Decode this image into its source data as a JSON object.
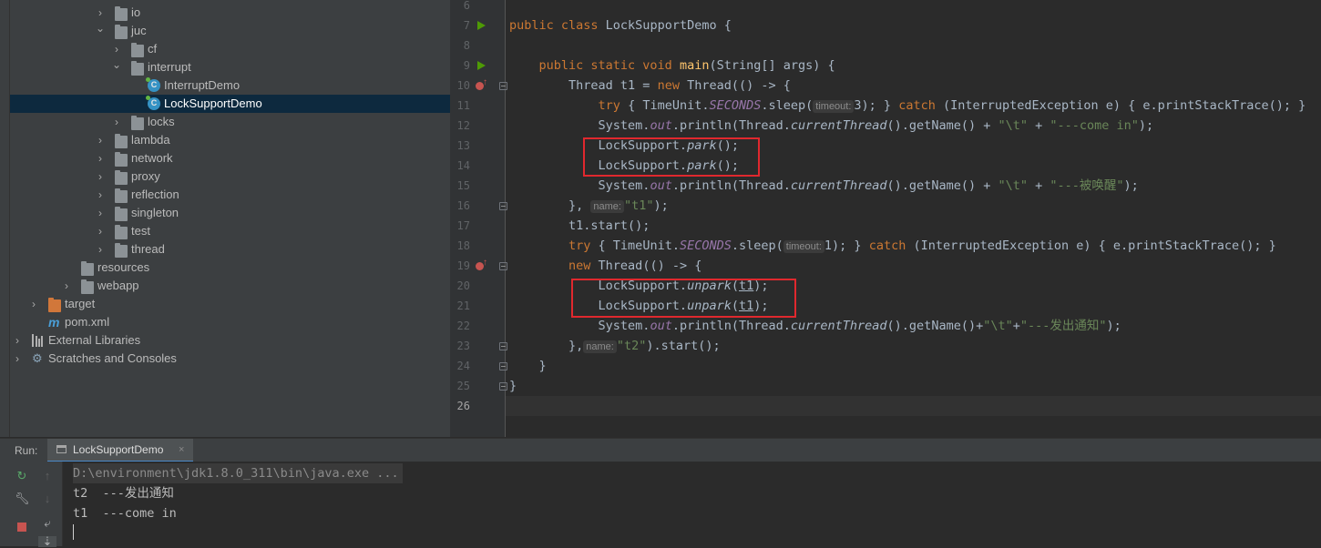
{
  "project_tree": {
    "items": [
      {
        "label": "io",
        "type": "folder",
        "indent": 1,
        "expanded": false
      },
      {
        "label": "juc",
        "type": "folder",
        "indent": 1,
        "expanded": true
      },
      {
        "label": "cf",
        "type": "folder",
        "indent": 2,
        "expanded": false
      },
      {
        "label": "interrupt",
        "type": "folder",
        "indent": 2,
        "expanded": true
      },
      {
        "label": "InterruptDemo",
        "type": "class",
        "indent": 3
      },
      {
        "label": "LockSupportDemo",
        "type": "class",
        "indent": 3,
        "selected": true
      },
      {
        "label": "locks",
        "type": "folder",
        "indent": 2,
        "expanded": false
      },
      {
        "label": "lambda",
        "type": "folder",
        "indent": 1,
        "expanded": false
      },
      {
        "label": "network",
        "type": "folder",
        "indent": 1,
        "expanded": false
      },
      {
        "label": "proxy",
        "type": "folder",
        "indent": 1,
        "expanded": false
      },
      {
        "label": "reflection",
        "type": "folder",
        "indent": 1,
        "expanded": false
      },
      {
        "label": "singleton",
        "type": "folder",
        "indent": 1,
        "expanded": false
      },
      {
        "label": "test",
        "type": "folder",
        "indent": 1,
        "expanded": false
      },
      {
        "label": "thread",
        "type": "folder",
        "indent": 1,
        "expanded": false
      },
      {
        "label": "resources",
        "type": "resources",
        "indent": 0
      },
      {
        "label": "webapp",
        "type": "webapp",
        "indent": 0,
        "expanded": false
      },
      {
        "label": "target",
        "type": "target",
        "indent": -1,
        "expanded": false
      },
      {
        "label": "pom.xml",
        "type": "maven",
        "indent": -1
      },
      {
        "label": "External Libraries",
        "type": "libraries",
        "indent": -2,
        "expanded": false
      },
      {
        "label": "Scratches and Consoles",
        "type": "scratches",
        "indent": -2,
        "expanded": false
      }
    ]
  },
  "editor": {
    "line_numbers": [
      "6",
      "7",
      "8",
      "9",
      "10",
      "11",
      "12",
      "13",
      "14",
      "15",
      "16",
      "17",
      "18",
      "19",
      "20",
      "21",
      "22",
      "23",
      "24",
      "25",
      "26"
    ],
    "current_line": "26",
    "code_lines": [
      [],
      [
        {
          "t": "public class ",
          "c": "kw"
        },
        {
          "t": "LockSupportDemo {",
          "c": ""
        }
      ],
      [],
      [
        {
          "t": "    public static void ",
          "c": "kw"
        },
        {
          "t": "main",
          "c": "fn"
        },
        {
          "t": "(String[] args) {",
          "c": ""
        }
      ],
      [
        {
          "t": "        Thread t1 = ",
          "c": ""
        },
        {
          "t": "new ",
          "c": "kw"
        },
        {
          "t": "Thread(() -> {",
          "c": ""
        }
      ],
      [
        {
          "t": "            ",
          "c": ""
        },
        {
          "t": "try ",
          "c": "kw"
        },
        {
          "t": "{ TimeUnit.",
          "c": ""
        },
        {
          "t": "SECONDS",
          "c": "it"
        },
        {
          "t": ".sleep(",
          "c": ""
        },
        {
          "t": "timeout:",
          "c": "hint"
        },
        {
          "t": "3); } ",
          "c": ""
        },
        {
          "t": "catch ",
          "c": "kw"
        },
        {
          "t": "(InterruptedException e) { e.printStackTrace(); }",
          "c": ""
        }
      ],
      [
        {
          "t": "            System.",
          "c": ""
        },
        {
          "t": "out",
          "c": "it"
        },
        {
          "t": ".println(Thread.",
          "c": ""
        },
        {
          "t": "currentThread",
          "c": "stat"
        },
        {
          "t": "().getName() + ",
          "c": ""
        },
        {
          "t": "\"\\t\"",
          "c": "st"
        },
        {
          "t": " + ",
          "c": ""
        },
        {
          "t": "\"---come in\"",
          "c": "st"
        },
        {
          "t": ");",
          "c": ""
        }
      ],
      [
        {
          "t": "            LockSupport.",
          "c": ""
        },
        {
          "t": "park",
          "c": "stat"
        },
        {
          "t": "();",
          "c": ""
        }
      ],
      [
        {
          "t": "            LockSupport.",
          "c": ""
        },
        {
          "t": "park",
          "c": "stat"
        },
        {
          "t": "();",
          "c": ""
        }
      ],
      [
        {
          "t": "            System.",
          "c": ""
        },
        {
          "t": "out",
          "c": "it"
        },
        {
          "t": ".println(Thread.",
          "c": ""
        },
        {
          "t": "currentThread",
          "c": "stat"
        },
        {
          "t": "().getName() + ",
          "c": ""
        },
        {
          "t": "\"\\t\"",
          "c": "st"
        },
        {
          "t": " + ",
          "c": ""
        },
        {
          "t": "\"---被唤醒\"",
          "c": "st"
        },
        {
          "t": ");",
          "c": ""
        }
      ],
      [
        {
          "t": "        }, ",
          "c": ""
        },
        {
          "t": "name:",
          "c": "hint"
        },
        {
          "t": "\"t1\"",
          "c": "st"
        },
        {
          "t": ");",
          "c": ""
        }
      ],
      [
        {
          "t": "        t1.start();",
          "c": ""
        }
      ],
      [
        {
          "t": "        ",
          "c": ""
        },
        {
          "t": "try ",
          "c": "kw"
        },
        {
          "t": "{ TimeUnit.",
          "c": ""
        },
        {
          "t": "SECONDS",
          "c": "it"
        },
        {
          "t": ".sleep(",
          "c": ""
        },
        {
          "t": "timeout:",
          "c": "hint"
        },
        {
          "t": "1); } ",
          "c": ""
        },
        {
          "t": "catch ",
          "c": "kw"
        },
        {
          "t": "(InterruptedException e) { e.printStackTrace(); }",
          "c": ""
        }
      ],
      [
        {
          "t": "        ",
          "c": ""
        },
        {
          "t": "new ",
          "c": "kw"
        },
        {
          "t": "Thread(() -> {",
          "c": ""
        }
      ],
      [
        {
          "t": "            LockSupport.",
          "c": ""
        },
        {
          "t": "unpark",
          "c": "stat"
        },
        {
          "t": "(",
          "c": ""
        },
        {
          "t": "t1",
          "c": "ul"
        },
        {
          "t": ");",
          "c": ""
        }
      ],
      [
        {
          "t": "            LockSupport.",
          "c": ""
        },
        {
          "t": "unpark",
          "c": "stat"
        },
        {
          "t": "(",
          "c": ""
        },
        {
          "t": "t1",
          "c": "ul"
        },
        {
          "t": ");",
          "c": ""
        }
      ],
      [
        {
          "t": "            System.",
          "c": ""
        },
        {
          "t": "out",
          "c": "it"
        },
        {
          "t": ".println(Thread.",
          "c": ""
        },
        {
          "t": "currentThread",
          "c": "stat"
        },
        {
          "t": "().getName()+",
          "c": ""
        },
        {
          "t": "\"\\t\"",
          "c": "st"
        },
        {
          "t": "+",
          "c": ""
        },
        {
          "t": "\"---发出通知\"",
          "c": "st"
        },
        {
          "t": ");",
          "c": ""
        }
      ],
      [
        {
          "t": "        },",
          "c": ""
        },
        {
          "t": "name:",
          "c": "hint"
        },
        {
          "t": "\"t2\"",
          "c": "st"
        },
        {
          "t": ").start();",
          "c": ""
        }
      ],
      [
        {
          "t": "    }",
          "c": ""
        }
      ],
      [
        {
          "t": "}",
          "c": ""
        }
      ],
      []
    ]
  },
  "run_panel": {
    "label": "Run:",
    "tab_title": "LockSupportDemo",
    "tab_close": "×",
    "console_lines": [
      "D:\\environment\\jdk1.8.0_311\\bin\\java.exe ...",
      "t2  ---发出通知",
      "t1  ---come in"
    ]
  },
  "colors": {
    "keyword": "#cc7832",
    "string": "#6a8759",
    "method_decl": "#ffc66d",
    "static_field": "#9876aa",
    "highlight_box": "#e0282e",
    "selection": "#0d293e"
  }
}
